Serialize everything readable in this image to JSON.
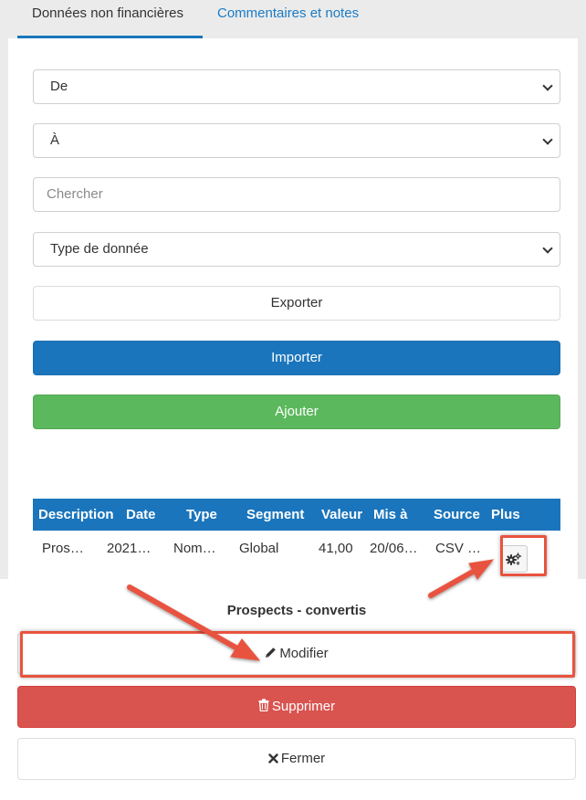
{
  "tabs": [
    {
      "label": "Données non financières"
    },
    {
      "label": "Commentaires et notes"
    }
  ],
  "filters": {
    "from": "De",
    "to": "À",
    "search_placeholder": "Chercher",
    "data_type": "Type de donnée"
  },
  "buttons": {
    "export": "Exporter",
    "import": "Importer",
    "add": "Ajouter"
  },
  "table": {
    "headers": [
      "Description",
      "Date",
      "Type",
      "Segment",
      "Valeur",
      "Mis à",
      "Source",
      "Plus"
    ],
    "row": [
      "Pros…",
      "2021…",
      "Nom…",
      "Global",
      "41,00",
      "20/06…",
      "CSV …"
    ]
  },
  "actions": {
    "title": "Prospects - convertis",
    "edit": "Modifier",
    "delete": "Supprimer",
    "close": "Fermer"
  },
  "colors": {
    "primary": "#1a75bc",
    "success": "#5cb85c",
    "danger": "#d9534f",
    "annotation": "#e8533f"
  },
  "icons": {
    "more": "gears-icon",
    "edit": "pencil-icon",
    "delete": "trash-icon",
    "close": "x-icon"
  }
}
